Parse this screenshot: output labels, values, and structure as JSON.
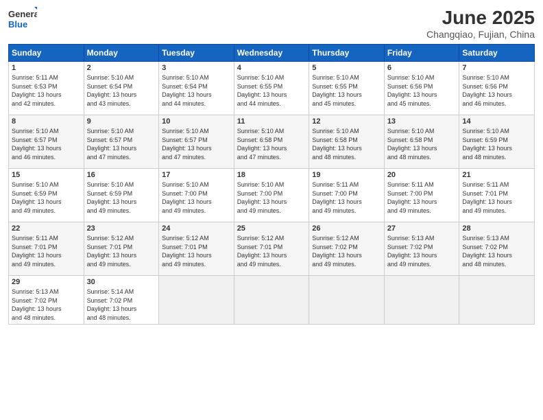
{
  "header": {
    "logo_general": "General",
    "logo_blue": "Blue",
    "month_title": "June 2025",
    "location": "Changqiao, Fujian, China"
  },
  "weekdays": [
    "Sunday",
    "Monday",
    "Tuesday",
    "Wednesday",
    "Thursday",
    "Friday",
    "Saturday"
  ],
  "weeks": [
    [
      {
        "day": "1",
        "info": "Sunrise: 5:11 AM\nSunset: 6:53 PM\nDaylight: 13 hours\nand 42 minutes."
      },
      {
        "day": "2",
        "info": "Sunrise: 5:10 AM\nSunset: 6:54 PM\nDaylight: 13 hours\nand 43 minutes."
      },
      {
        "day": "3",
        "info": "Sunrise: 5:10 AM\nSunset: 6:54 PM\nDaylight: 13 hours\nand 44 minutes."
      },
      {
        "day": "4",
        "info": "Sunrise: 5:10 AM\nSunset: 6:55 PM\nDaylight: 13 hours\nand 44 minutes."
      },
      {
        "day": "5",
        "info": "Sunrise: 5:10 AM\nSunset: 6:55 PM\nDaylight: 13 hours\nand 45 minutes."
      },
      {
        "day": "6",
        "info": "Sunrise: 5:10 AM\nSunset: 6:56 PM\nDaylight: 13 hours\nand 45 minutes."
      },
      {
        "day": "7",
        "info": "Sunrise: 5:10 AM\nSunset: 6:56 PM\nDaylight: 13 hours\nand 46 minutes."
      }
    ],
    [
      {
        "day": "8",
        "info": "Sunrise: 5:10 AM\nSunset: 6:57 PM\nDaylight: 13 hours\nand 46 minutes."
      },
      {
        "day": "9",
        "info": "Sunrise: 5:10 AM\nSunset: 6:57 PM\nDaylight: 13 hours\nand 47 minutes."
      },
      {
        "day": "10",
        "info": "Sunrise: 5:10 AM\nSunset: 6:57 PM\nDaylight: 13 hours\nand 47 minutes."
      },
      {
        "day": "11",
        "info": "Sunrise: 5:10 AM\nSunset: 6:58 PM\nDaylight: 13 hours\nand 47 minutes."
      },
      {
        "day": "12",
        "info": "Sunrise: 5:10 AM\nSunset: 6:58 PM\nDaylight: 13 hours\nand 48 minutes."
      },
      {
        "day": "13",
        "info": "Sunrise: 5:10 AM\nSunset: 6:58 PM\nDaylight: 13 hours\nand 48 minutes."
      },
      {
        "day": "14",
        "info": "Sunrise: 5:10 AM\nSunset: 6:59 PM\nDaylight: 13 hours\nand 48 minutes."
      }
    ],
    [
      {
        "day": "15",
        "info": "Sunrise: 5:10 AM\nSunset: 6:59 PM\nDaylight: 13 hours\nand 49 minutes."
      },
      {
        "day": "16",
        "info": "Sunrise: 5:10 AM\nSunset: 6:59 PM\nDaylight: 13 hours\nand 49 minutes."
      },
      {
        "day": "17",
        "info": "Sunrise: 5:10 AM\nSunset: 7:00 PM\nDaylight: 13 hours\nand 49 minutes."
      },
      {
        "day": "18",
        "info": "Sunrise: 5:10 AM\nSunset: 7:00 PM\nDaylight: 13 hours\nand 49 minutes."
      },
      {
        "day": "19",
        "info": "Sunrise: 5:11 AM\nSunset: 7:00 PM\nDaylight: 13 hours\nand 49 minutes."
      },
      {
        "day": "20",
        "info": "Sunrise: 5:11 AM\nSunset: 7:00 PM\nDaylight: 13 hours\nand 49 minutes."
      },
      {
        "day": "21",
        "info": "Sunrise: 5:11 AM\nSunset: 7:01 PM\nDaylight: 13 hours\nand 49 minutes."
      }
    ],
    [
      {
        "day": "22",
        "info": "Sunrise: 5:11 AM\nSunset: 7:01 PM\nDaylight: 13 hours\nand 49 minutes."
      },
      {
        "day": "23",
        "info": "Sunrise: 5:12 AM\nSunset: 7:01 PM\nDaylight: 13 hours\nand 49 minutes."
      },
      {
        "day": "24",
        "info": "Sunrise: 5:12 AM\nSunset: 7:01 PM\nDaylight: 13 hours\nand 49 minutes."
      },
      {
        "day": "25",
        "info": "Sunrise: 5:12 AM\nSunset: 7:01 PM\nDaylight: 13 hours\nand 49 minutes."
      },
      {
        "day": "26",
        "info": "Sunrise: 5:12 AM\nSunset: 7:02 PM\nDaylight: 13 hours\nand 49 minutes."
      },
      {
        "day": "27",
        "info": "Sunrise: 5:13 AM\nSunset: 7:02 PM\nDaylight: 13 hours\nand 49 minutes."
      },
      {
        "day": "28",
        "info": "Sunrise: 5:13 AM\nSunset: 7:02 PM\nDaylight: 13 hours\nand 48 minutes."
      }
    ],
    [
      {
        "day": "29",
        "info": "Sunrise: 5:13 AM\nSunset: 7:02 PM\nDaylight: 13 hours\nand 48 minutes."
      },
      {
        "day": "30",
        "info": "Sunrise: 5:14 AM\nSunset: 7:02 PM\nDaylight: 13 hours\nand 48 minutes."
      },
      {
        "day": "",
        "info": ""
      },
      {
        "day": "",
        "info": ""
      },
      {
        "day": "",
        "info": ""
      },
      {
        "day": "",
        "info": ""
      },
      {
        "day": "",
        "info": ""
      }
    ]
  ]
}
